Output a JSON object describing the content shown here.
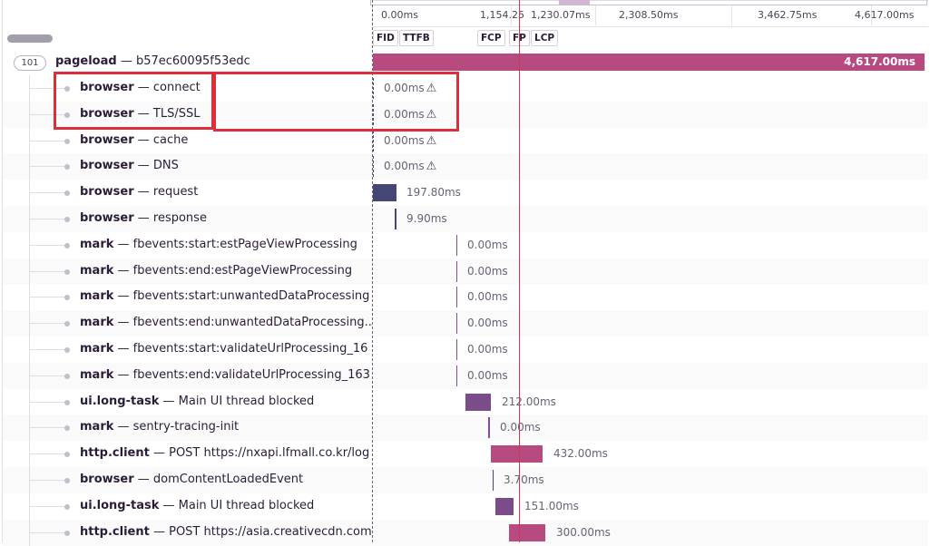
{
  "header": {
    "ticks": [
      "0.00ms",
      "1,154.25",
      "1,230.07ms",
      "2,308.50ms",
      "3,462.75ms",
      "4,617.00ms"
    ],
    "vitals": [
      "FID",
      "TTFB",
      "FCP",
      "FP",
      "LCP"
    ]
  },
  "root": {
    "count": "101",
    "op": "pageload",
    "desc": "b57ec60095f53edc",
    "duration": "4,617.00ms",
    "color": "#b74b7f"
  },
  "spans": [
    {
      "op": "browser",
      "desc": "connect",
      "duration": "0.00ms",
      "warning": true
    },
    {
      "op": "browser",
      "desc": "TLS/SSL",
      "duration": "0.00ms",
      "warning": true
    },
    {
      "op": "browser",
      "desc": "cache",
      "duration": "0.00ms",
      "warning": true
    },
    {
      "op": "browser",
      "desc": "DNS",
      "duration": "0.00ms",
      "warning": true
    },
    {
      "op": "browser",
      "desc": "request",
      "duration": "197.80ms"
    },
    {
      "op": "browser",
      "desc": "response",
      "duration": "9.90ms"
    },
    {
      "op": "mark",
      "desc": "fbevents:start:estPageViewProcessing",
      "duration": "0.00ms"
    },
    {
      "op": "mark",
      "desc": "fbevents:end:estPageViewProcessing",
      "duration": "0.00ms"
    },
    {
      "op": "mark",
      "desc": "fbevents:start:unwantedDataProcessing",
      "duration": "0.00ms"
    },
    {
      "op": "mark",
      "desc": "fbevents:end:unwantedDataProcessing...",
      "duration": "0.00ms"
    },
    {
      "op": "mark",
      "desc": "fbevents:start:validateUrlProcessing_16",
      "duration": "0.00ms"
    },
    {
      "op": "mark",
      "desc": "fbevents:end:validateUrlProcessing_163",
      "duration": "0.00ms"
    },
    {
      "op": "ui.long-task",
      "desc": "Main UI thread blocked",
      "duration": "212.00ms"
    },
    {
      "op": "mark",
      "desc": "sentry-tracing-init",
      "duration": "0.00ms"
    },
    {
      "op": "http.client",
      "desc": "POST https://nxapi.lfmall.co.kr/log",
      "duration": "432.00ms"
    },
    {
      "op": "browser",
      "desc": "domContentLoadedEvent",
      "duration": "3.70ms"
    },
    {
      "op": "ui.long-task",
      "desc": "Main UI thread blocked",
      "duration": "151.00ms"
    },
    {
      "op": "http.client",
      "desc": "POST https://asia.creativecdn.com",
      "duration": "300.00ms"
    }
  ],
  "colors": {
    "browser": "#444674",
    "mark": "#7a5195",
    "ui.long-task": "#7a4c8a",
    "http.client": "#b74b7f",
    "cursor": "#c63a5a",
    "annotation": "#e02d38"
  }
}
